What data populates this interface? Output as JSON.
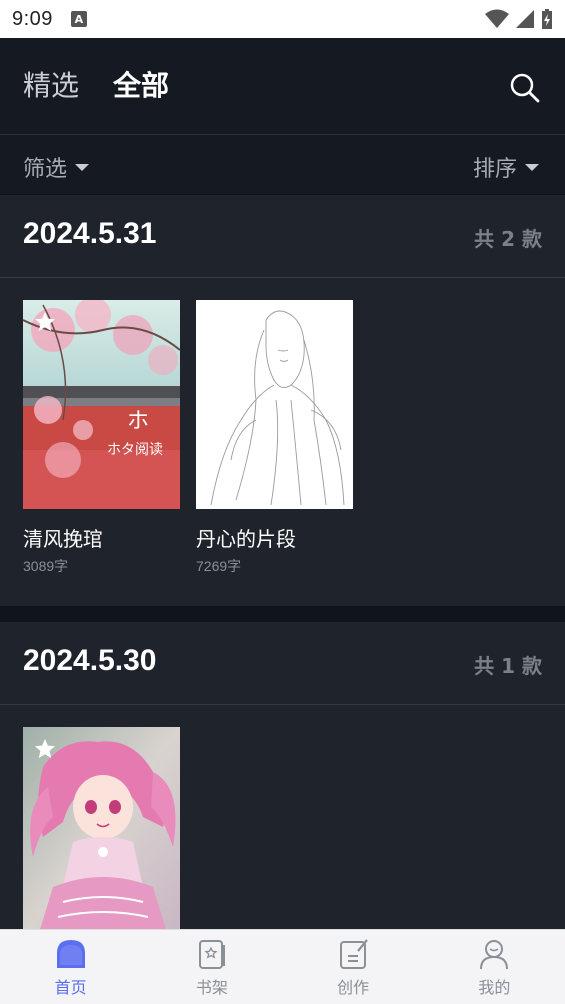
{
  "status_bar": {
    "time": "9:09",
    "notification_glyph": "A"
  },
  "header": {
    "tabs": [
      {
        "label": "精选"
      },
      {
        "label": "全部"
      }
    ],
    "active_tab": "全部"
  },
  "filter_bar": {
    "filter_label": "筛选",
    "sort_label": "排序"
  },
  "sections": [
    {
      "date": "2024.5.31",
      "count": "共 2 款",
      "books": [
        {
          "title": "清风挽琯",
          "words": "3089字",
          "cover_text": "ホタ阅读",
          "starred": true
        },
        {
          "title": "丹心的片段",
          "words": "7269字",
          "starred": false
        }
      ]
    },
    {
      "date": "2024.5.30",
      "count": "共 1 款",
      "books": [
        {
          "title": "",
          "words": "",
          "starred": true
        }
      ]
    }
  ],
  "bottom_nav": {
    "items": [
      {
        "label": "首页",
        "icon": "home-icon",
        "active": true
      },
      {
        "label": "书架",
        "icon": "bookshelf-icon",
        "active": false
      },
      {
        "label": "创作",
        "icon": "create-icon",
        "active": false
      },
      {
        "label": "我的",
        "icon": "profile-icon",
        "active": false
      }
    ]
  },
  "colors": {
    "accent": "#5a6ef0",
    "background": "#10141b",
    "section_bg": "#1f232c"
  }
}
